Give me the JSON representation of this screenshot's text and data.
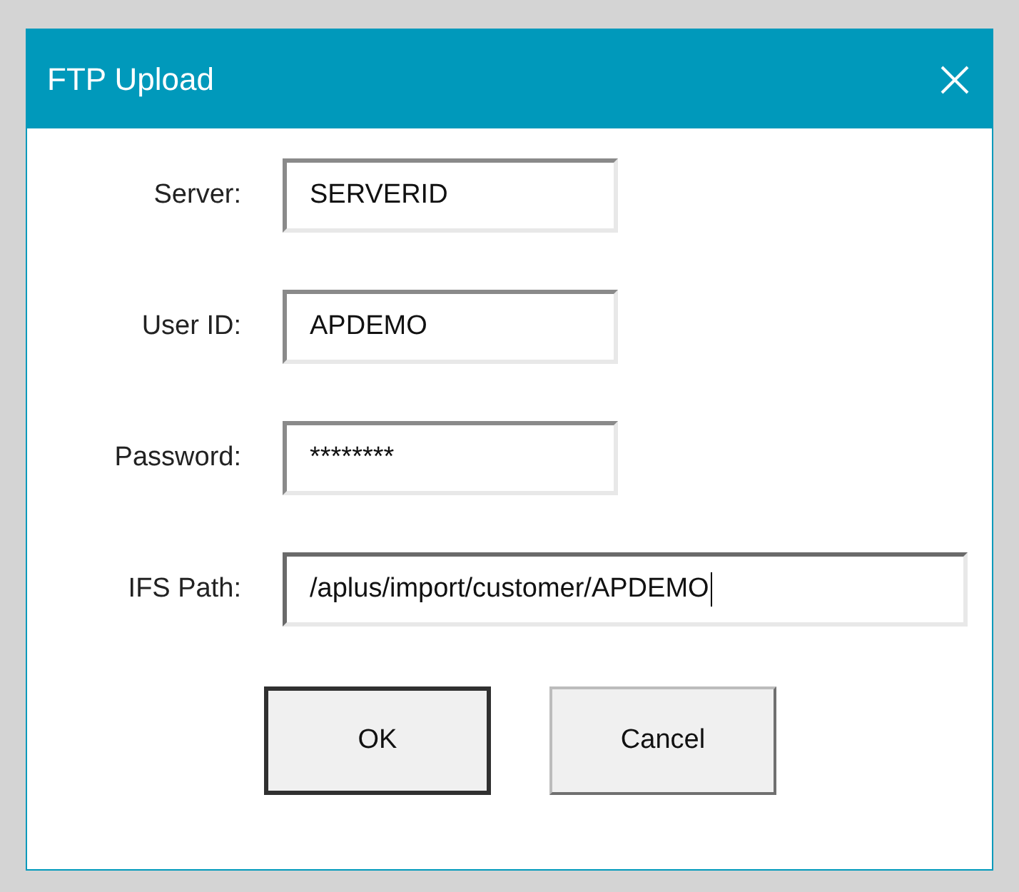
{
  "window": {
    "title": "FTP Upload"
  },
  "fields": [
    {
      "label": "Server:",
      "value": "SERVERID",
      "wide": false,
      "focused": false
    },
    {
      "label": "User ID:",
      "value": "APDEMO",
      "wide": false,
      "focused": false
    },
    {
      "label": "Password:",
      "value": "********",
      "wide": false,
      "focused": false
    },
    {
      "label": "IFS Path:",
      "value": "/aplus/import/customer/APDEMO",
      "wide": true,
      "focused": true
    }
  ],
  "buttons": [
    {
      "label": "OK",
      "default": true
    },
    {
      "label": "Cancel",
      "default": false
    }
  ]
}
